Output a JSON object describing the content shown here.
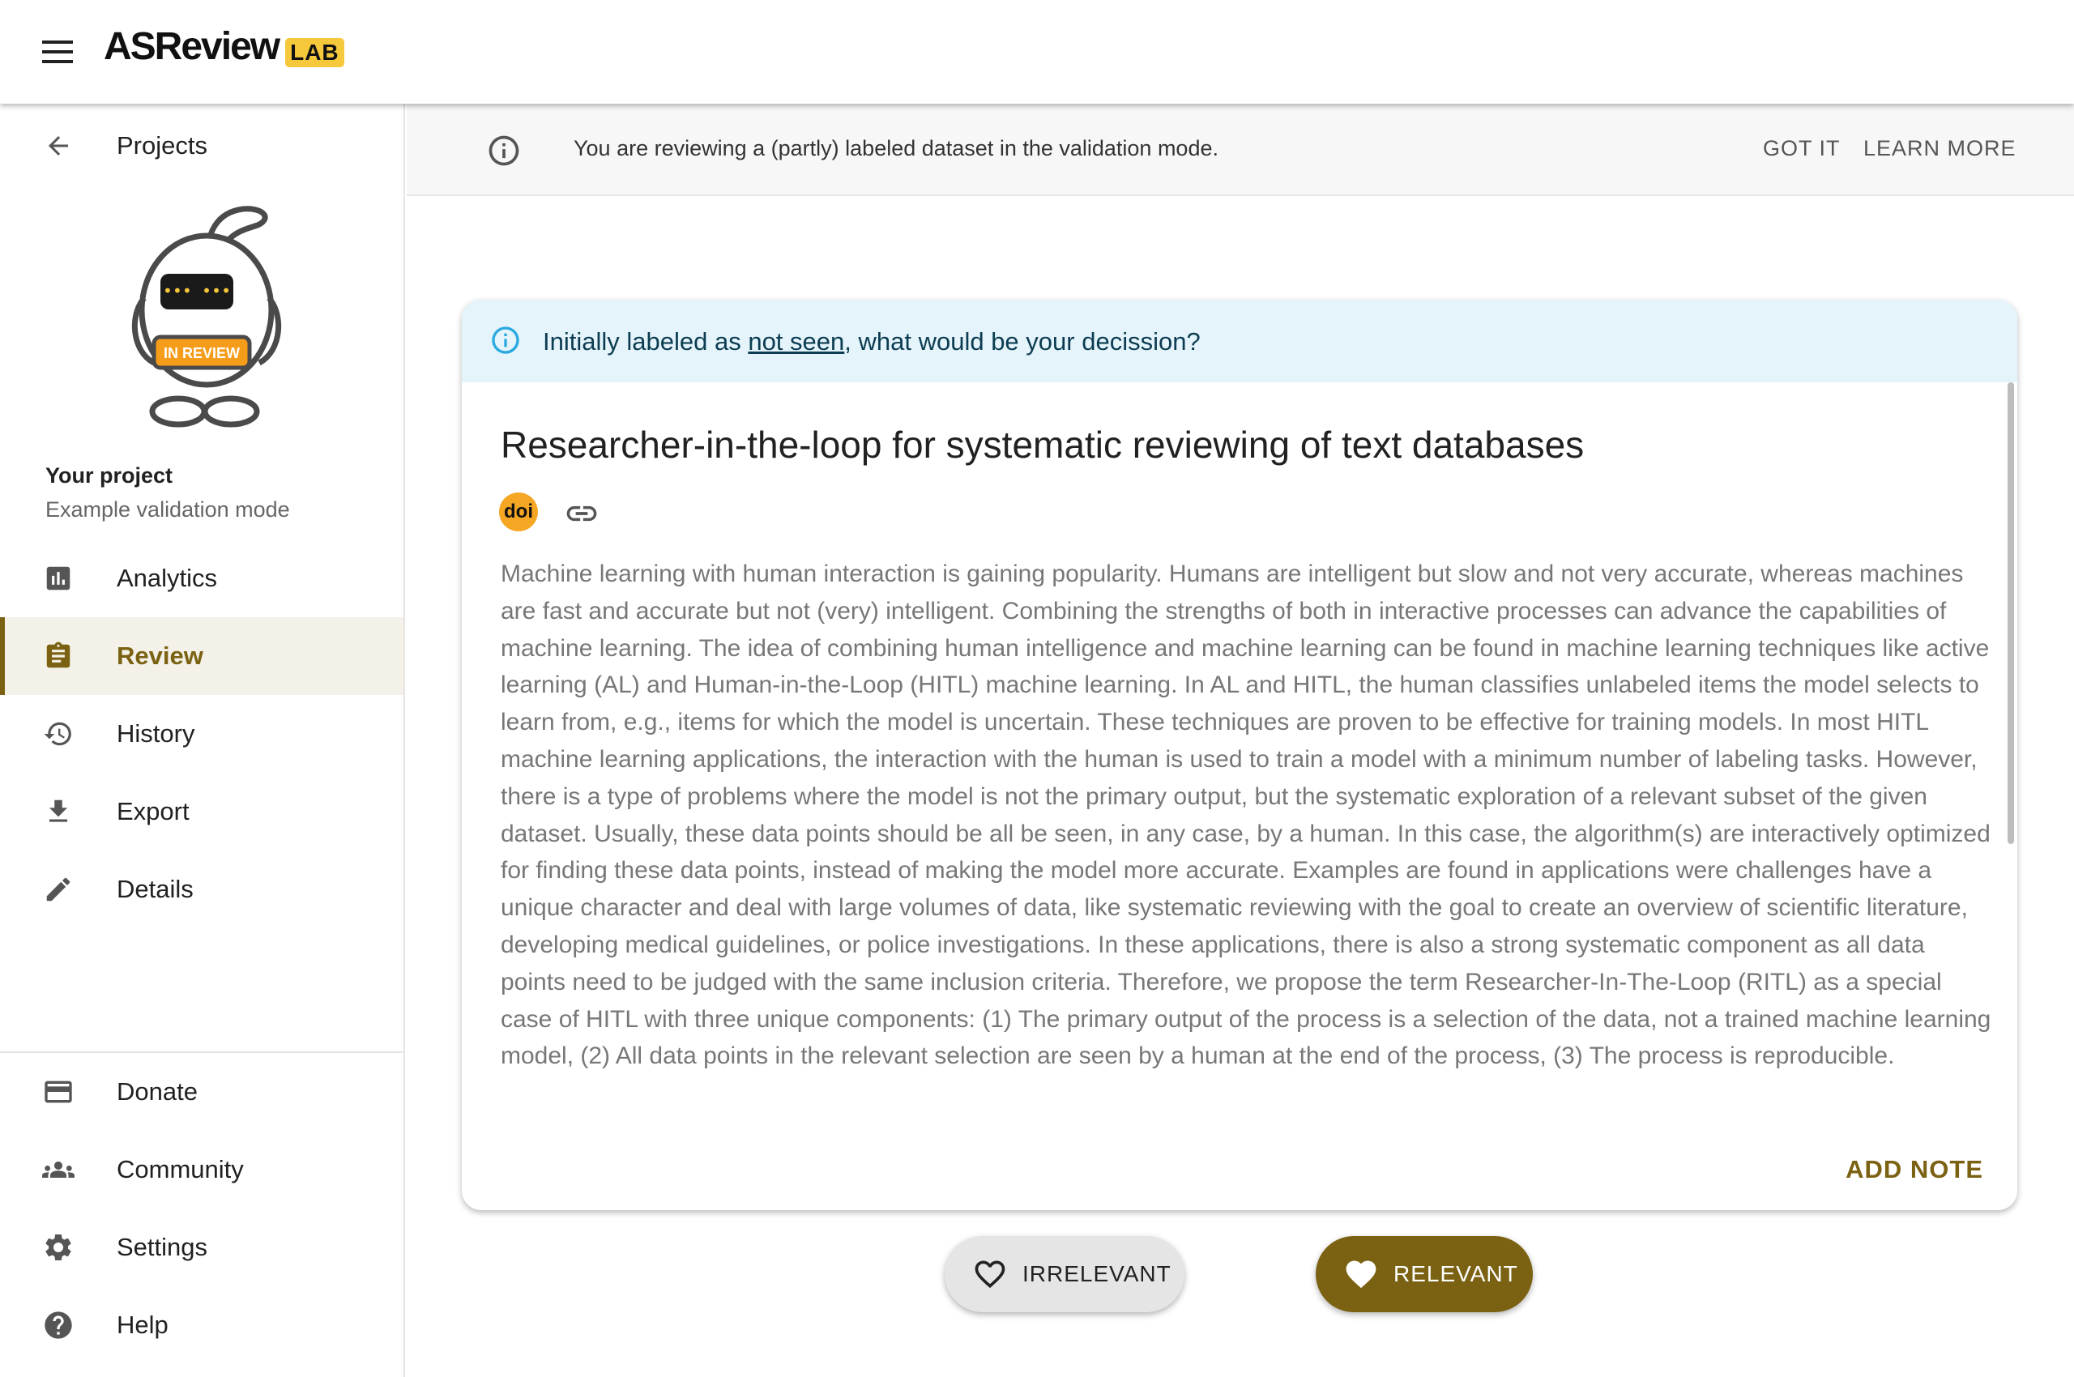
{
  "app": {
    "logo_main": "ASReview",
    "logo_badge": "LAB"
  },
  "sidebar": {
    "back_label": "Projects",
    "project_title": "Your project",
    "project_subtitle": "Example validation mode",
    "robot_badge": "IN REVIEW",
    "items": [
      {
        "label": "Analytics",
        "icon": "bar-chart-icon"
      },
      {
        "label": "Review",
        "icon": "clipboard-icon",
        "active": true
      },
      {
        "label": "History",
        "icon": "history-icon"
      },
      {
        "label": "Export",
        "icon": "download-icon"
      },
      {
        "label": "Details",
        "icon": "pencil-icon"
      }
    ],
    "bottom_items": [
      {
        "label": "Donate",
        "icon": "credit-card-icon"
      },
      {
        "label": "Community",
        "icon": "people-icon"
      },
      {
        "label": "Settings",
        "icon": "gear-icon"
      },
      {
        "label": "Help",
        "icon": "help-icon"
      }
    ]
  },
  "banner": {
    "message": "You are reviewing a (partly) labeled dataset in the validation mode.",
    "got_it": "GOT IT",
    "learn_more": "LEARN MORE"
  },
  "record": {
    "alert_prefix": "Initially labeled as ",
    "alert_link": "not seen",
    "alert_suffix": ", what would be your decission?",
    "title": "Researcher-in-the-loop for systematic reviewing of text databases",
    "doi_label": "doi",
    "abstract": "Machine learning with human interaction is gaining popularity. Humans are intelligent but slow and not very accurate, whereas machines are fast and accurate but not (very) intelligent. Combining the strengths of both in interactive processes can advance the capabilities of machine learning. The idea of combining human intelligence and machine learning can be found in machine learning techniques like active learning (AL) and Human-in-the-Loop (HITL) machine learning. In AL and HITL, the human classifies unlabeled items the model selects to learn from, e.g., items for which the model is uncertain. These techniques are proven to be effective for training models. In most HITL machine learning applications, the interaction with the human is used to train a model with a minimum number of labeling tasks. However, there is a type of problems where the model is not the primary output, but the systematic exploration of a relevant subset of the given dataset. Usually, these data points should be all be seen, in any case, by a human. In this case, the algorithm(s) are interactively optimized for finding these data points, instead of making the model more accurate. Examples are found in applications were challenges have a unique character and deal with large volumes of data, like systematic reviewing with the goal to create an overview of scientific literature, developing medical guidelines, or police investigations. In these applications, there is also a strong systematic component as all data points need to be judged with the same inclusion criteria. Therefore, we propose the term Researcher-In-The-Loop (RITL) as a special case of HITL with three unique components: (1) The primary output of the process is a selection of the data, not a trained machine learning model, (2) All data points in the relevant selection are seen by a human at the end of the process, (3) The process is reproducible."
  },
  "actions": {
    "add_note": "ADD NOTE",
    "irrelevant": "IRRELEVANT",
    "relevant": "RELEVANT"
  },
  "colors": {
    "accent": "#7b6213",
    "alert_bg": "#e4f4fa",
    "logo_badge": "#f6c83c"
  }
}
